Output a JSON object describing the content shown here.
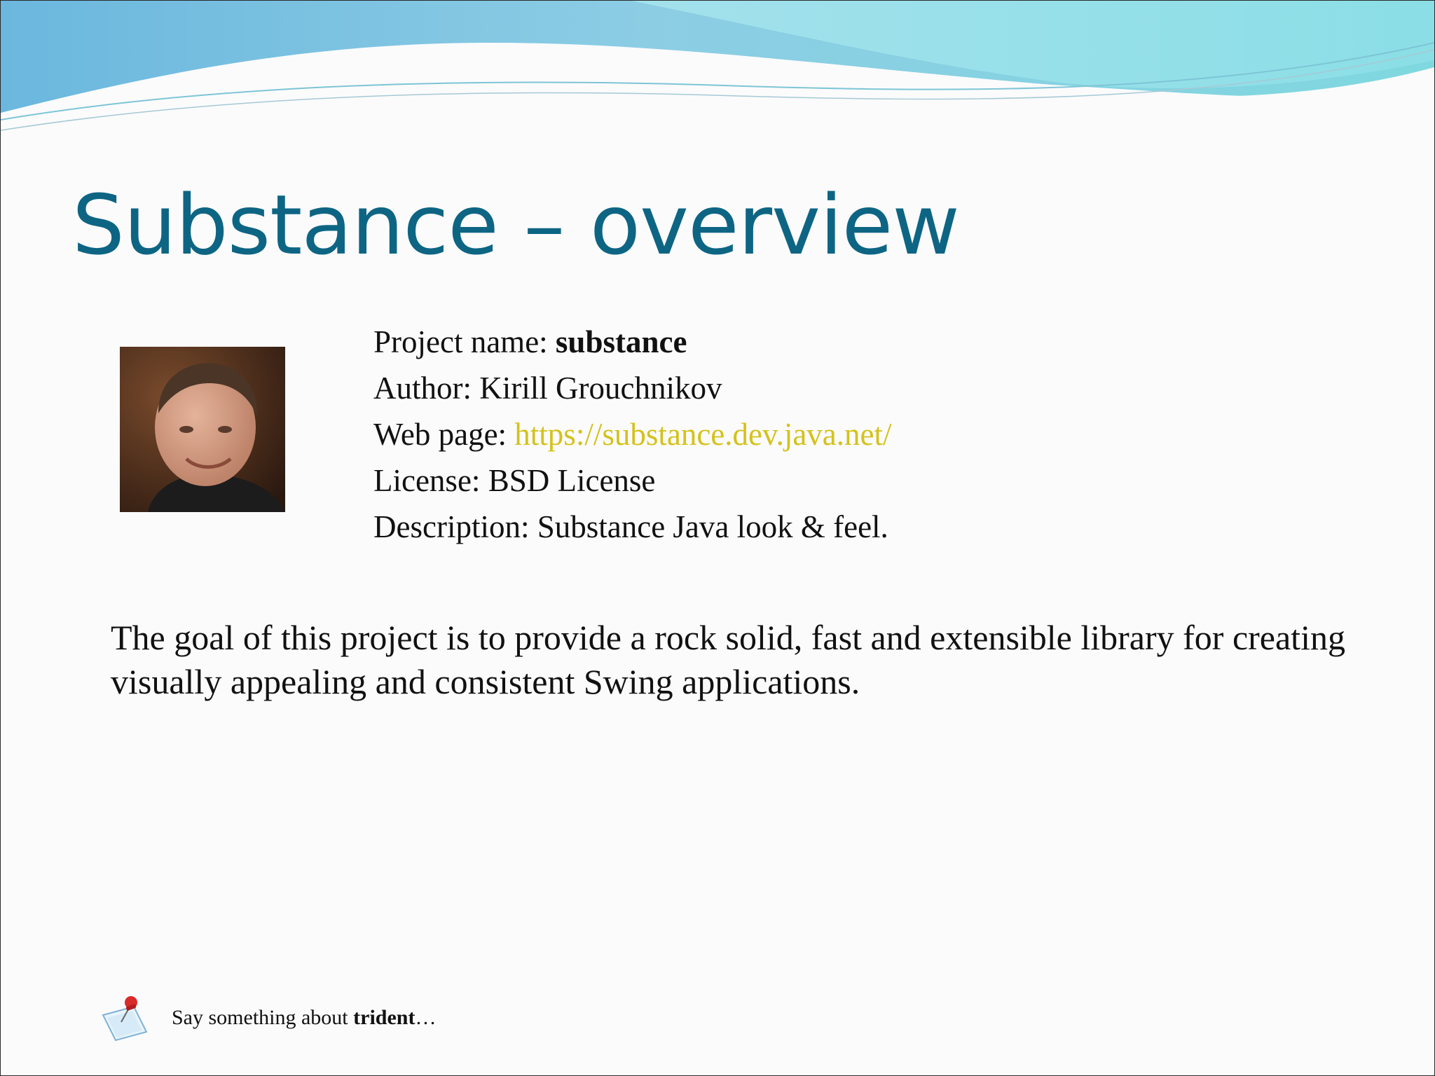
{
  "slide": {
    "title": "Substance – overview",
    "info": {
      "project_label": "Project name: ",
      "project_value": "substance",
      "author_label": "Author: ",
      "author_value": "Kirill Grouchnikov",
      "webpage_label": "Web page: ",
      "webpage_value": "https://substance.dev.java.net/",
      "license_label": "License: ",
      "license_value": "BSD License",
      "description_label": "Description: ",
      "description_value": "Substance Java look & feel."
    },
    "goal_text": "The goal of this project is to provide a rock solid, fast and extensible library for creating visually appealing and consistent Swing applications.",
    "footer": {
      "prefix": "Say something about ",
      "bold": "trident",
      "suffix": "…"
    }
  },
  "colors": {
    "title": "#0d6583",
    "link": "#d4c21a",
    "wave_light": "#8fd9e3",
    "wave_dark": "#5fa9d8"
  },
  "icons": {
    "photo": "author-photo",
    "footer": "pushpin-note-icon"
  }
}
